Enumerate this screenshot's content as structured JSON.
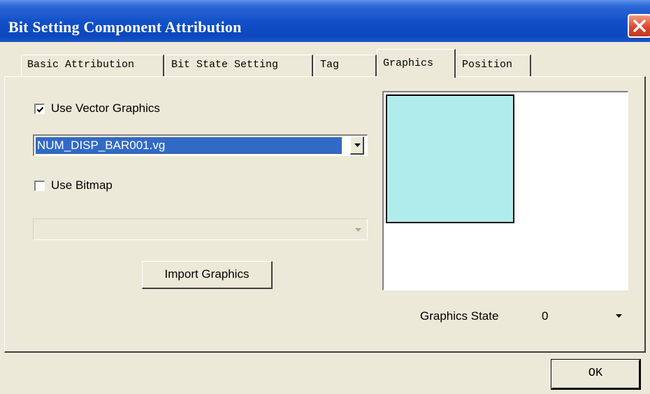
{
  "window": {
    "title": "Bit Setting Component Attribution"
  },
  "tabs": [
    {
      "label": "Basic Attribution",
      "active": false
    },
    {
      "label": "Bit State Setting",
      "active": false
    },
    {
      "label": "Tag",
      "active": false
    },
    {
      "label": "Graphics",
      "active": true
    },
    {
      "label": "Position",
      "active": false
    }
  ],
  "graphics": {
    "use_vector": {
      "label": "Use Vector Graphics",
      "checked": true
    },
    "vector_file": "NUM_DISP_BAR001.vg",
    "use_bitmap": {
      "label": "Use Bitmap",
      "checked": false
    },
    "bitmap_file": "",
    "import_label": "Import Graphics",
    "preview_fill": "#b0ecec",
    "state_label": "Graphics State",
    "state_value": "0"
  },
  "footer": {
    "ok_label": "OK"
  },
  "icons": {
    "close": "close-icon",
    "dropdown": "chevron-down-icon",
    "check": "checkmark-icon"
  }
}
